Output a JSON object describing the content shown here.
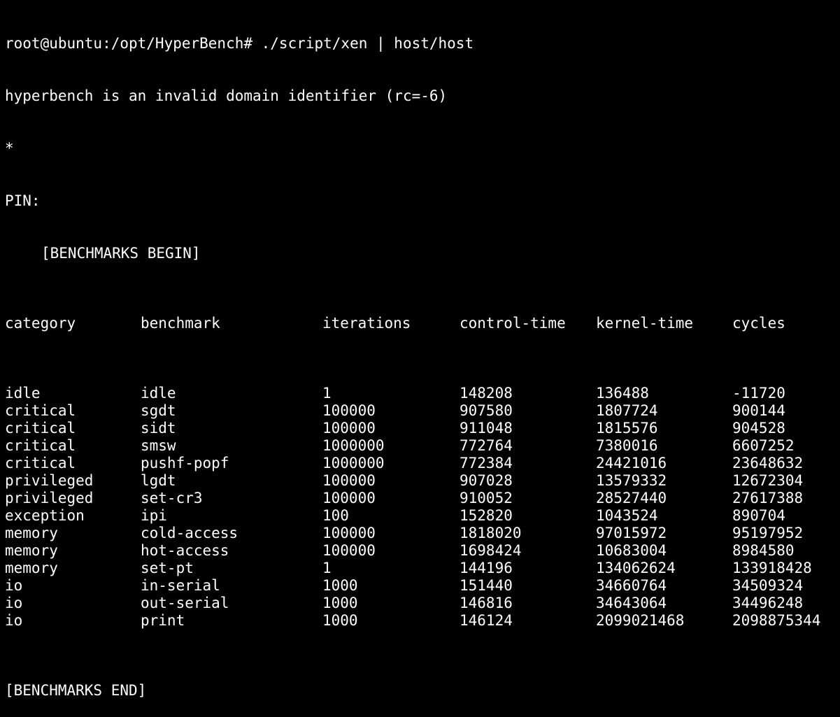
{
  "terminal": {
    "prompt_line": "root@ubuntu:/opt/HyperBench# ./script/xen | host/host",
    "error_line": "hyperbench is an invalid domain identifier (rc=-6)",
    "star_line": "*",
    "pin_line": "PIN:",
    "begin_line": "[BENCHMARKS BEGIN]",
    "end_line": "[BENCHMARKS END]",
    "colors": {
      "background": "#000000",
      "foreground": "#ffffff"
    }
  },
  "table": {
    "headers": [
      "category",
      "benchmark",
      "iterations",
      "control-time",
      "kernel-time",
      "cycles"
    ],
    "rows": [
      [
        "idle",
        "idle",
        "1",
        "148208",
        "136488",
        "-11720"
      ],
      [
        "critical",
        "sgdt",
        "100000",
        "907580",
        "1807724",
        "900144"
      ],
      [
        "critical",
        "sidt",
        "100000",
        "911048",
        "1815576",
        "904528"
      ],
      [
        "critical",
        "smsw",
        "1000000",
        "772764",
        "7380016",
        "6607252"
      ],
      [
        "critical",
        "pushf-popf",
        "1000000",
        "772384",
        "24421016",
        "23648632"
      ],
      [
        "privileged",
        "lgdt",
        "100000",
        "907028",
        "13579332",
        "12672304"
      ],
      [
        "privileged",
        "set-cr3",
        "100000",
        "910052",
        "28527440",
        "27617388"
      ],
      [
        "exception",
        "ipi",
        "100",
        "152820",
        "1043524",
        "890704"
      ],
      [
        "memory",
        "cold-access",
        "100000",
        "1818020",
        "97015972",
        "95197952"
      ],
      [
        "memory",
        "hot-access",
        "100000",
        "1698424",
        "10683004",
        "8984580"
      ],
      [
        "memory",
        "set-pt",
        "1",
        "144196",
        "134062624",
        "133918428"
      ],
      [
        "io",
        "in-serial",
        "1000",
        "151440",
        "34660764",
        "34509324"
      ],
      [
        "io",
        "out-serial",
        "1000",
        "146816",
        "34643064",
        "34496248"
      ],
      [
        "io",
        "print",
        "1000",
        "146124",
        "2099021468",
        "2098875344"
      ]
    ]
  }
}
